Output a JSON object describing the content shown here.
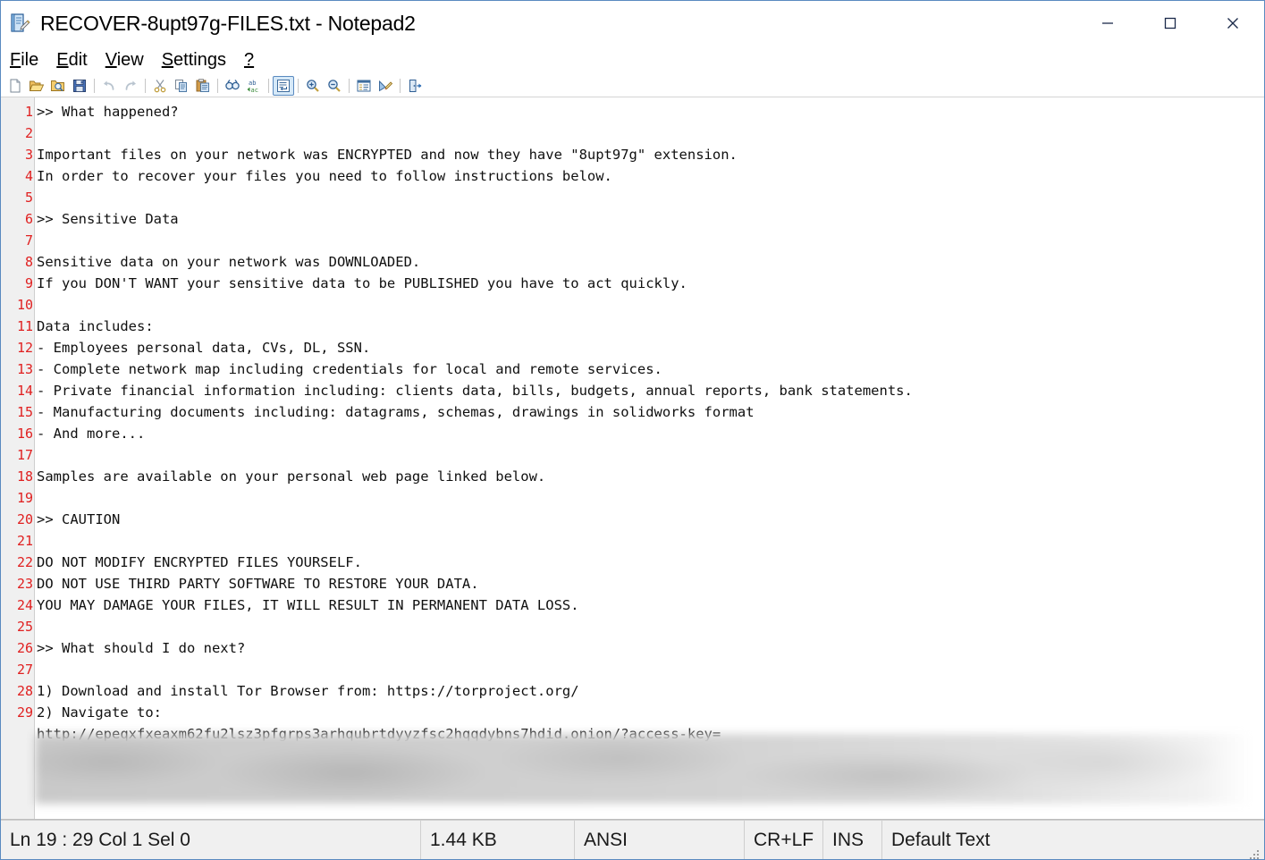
{
  "window": {
    "title": "RECOVER-8upt97g-FILES.txt - Notepad2",
    "app_icon": "notepad-document-icon",
    "controls": {
      "minimize": "minimize-icon",
      "maximize": "maximize-icon",
      "close": "close-icon"
    }
  },
  "menubar": {
    "items": [
      {
        "label": "File",
        "accel": "F"
      },
      {
        "label": "Edit",
        "accel": "E"
      },
      {
        "label": "View",
        "accel": "V"
      },
      {
        "label": "Settings",
        "accel": "S"
      },
      {
        "label": "?",
        "accel": "?"
      }
    ]
  },
  "toolbar": {
    "buttons": [
      {
        "name": "new-file-icon",
        "tip": "New"
      },
      {
        "name": "open-file-icon",
        "tip": "Open"
      },
      {
        "name": "browse-file-icon",
        "tip": "Browse"
      },
      {
        "name": "save-file-icon",
        "tip": "Save"
      },
      {
        "name": "undo-icon",
        "tip": "Undo"
      },
      {
        "name": "redo-icon",
        "tip": "Redo"
      },
      {
        "name": "cut-icon",
        "tip": "Cut"
      },
      {
        "name": "copy-icon",
        "tip": "Copy"
      },
      {
        "name": "paste-icon",
        "tip": "Paste"
      },
      {
        "name": "find-icon",
        "tip": "Find"
      },
      {
        "name": "replace-icon",
        "tip": "Replace"
      },
      {
        "name": "word-wrap-icon",
        "tip": "Word Wrap",
        "active": true
      },
      {
        "name": "zoom-in-icon",
        "tip": "Zoom In"
      },
      {
        "name": "zoom-out-icon",
        "tip": "Zoom Out"
      },
      {
        "name": "line-numbers-icon",
        "tip": "Line Numbers"
      },
      {
        "name": "scheme-edit-icon",
        "tip": "Customize Schemes"
      },
      {
        "name": "exit-icon",
        "tip": "Exit"
      }
    ]
  },
  "editor": {
    "line_number_color": "#e02020",
    "gutter_background": "#f0f0f0",
    "text_color": "#101010",
    "lines": [
      {
        "n": 1,
        "text": ">> What happened?"
      },
      {
        "n": 2,
        "text": ""
      },
      {
        "n": 3,
        "text": "Important files on your network was ENCRYPTED and now they have \"8upt97g\" extension."
      },
      {
        "n": 4,
        "text": "In order to recover your files you need to follow instructions below."
      },
      {
        "n": 5,
        "text": ""
      },
      {
        "n": 6,
        "text": ">> Sensitive Data"
      },
      {
        "n": 7,
        "text": ""
      },
      {
        "n": 8,
        "text": "Sensitive data on your network was DOWNLOADED."
      },
      {
        "n": 9,
        "text": "If you DON'T WANT your sensitive data to be PUBLISHED you have to act quickly."
      },
      {
        "n": 10,
        "text": ""
      },
      {
        "n": 11,
        "text": "Data includes:"
      },
      {
        "n": 12,
        "text": "- Employees personal data, CVs, DL, SSN."
      },
      {
        "n": 13,
        "text": "- Complete network map including credentials for local and remote services."
      },
      {
        "n": 14,
        "text": "- Private financial information including: clients data, bills, budgets, annual reports, bank statements."
      },
      {
        "n": 15,
        "text": "- Manufacturing documents including: datagrams, schemas, drawings in solidworks format"
      },
      {
        "n": 16,
        "text": "- And more..."
      },
      {
        "n": 17,
        "text": ""
      },
      {
        "n": 18,
        "text": "Samples are available on your personal web page linked below."
      },
      {
        "n": 19,
        "text": ""
      },
      {
        "n": 20,
        "text": ">> CAUTION"
      },
      {
        "n": 21,
        "text": ""
      },
      {
        "n": 22,
        "text": "DO NOT MODIFY ENCRYPTED FILES YOURSELF."
      },
      {
        "n": 23,
        "text": "DO NOT USE THIRD PARTY SOFTWARE TO RESTORE YOUR DATA."
      },
      {
        "n": 24,
        "text": "YOU MAY DAMAGE YOUR FILES, IT WILL RESULT IN PERMANENT DATA LOSS."
      },
      {
        "n": 25,
        "text": ""
      },
      {
        "n": 26,
        "text": ">> What should I do next?"
      },
      {
        "n": 27,
        "text": ""
      },
      {
        "n": 28,
        "text": "1) Download and install Tor Browser from: https://torproject.org/"
      },
      {
        "n": 29,
        "text": "2) Navigate to:"
      },
      {
        "n": "",
        "text": "http://epeqxfxeaxm62fu2lsz3pfgrps3arhqubrtdyyzfsc2hqqdybns7hdid.onion/?access-key="
      }
    ]
  },
  "statusbar": {
    "position": "Ln 19 : 29   Col 1   Sel 0",
    "file_size": "1.44 KB",
    "encoding": "ANSI",
    "line_endings": "CR+LF",
    "insert_mode": "INS",
    "scheme": "Default Text"
  }
}
